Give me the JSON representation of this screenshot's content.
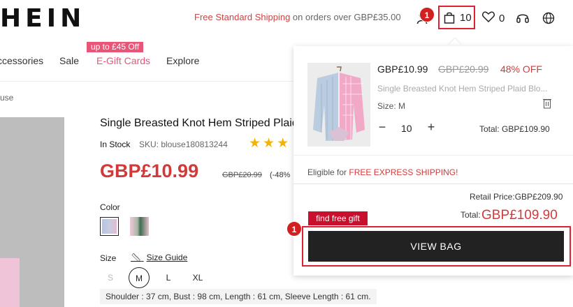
{
  "header": {
    "logo": "HEIN",
    "shipping_highlight": "Free Standard Shipping",
    "shipping_rest": " on orders over GBP£35.00",
    "bag_count": "10",
    "wishlist_count": "0",
    "step_badge": "1"
  },
  "nav": {
    "promo_tag": "up to £45 Off",
    "items": [
      "ccessories",
      "Sale",
      "E-Gift Cards",
      "Explore"
    ]
  },
  "product": {
    "breadcrumb": "use",
    "title": "Single Breasted Knot Hem Striped Plaid",
    "stock": "In Stock",
    "sku": "SKU: blouse180813244",
    "stars": "★★★",
    "price": "GBP£10.99",
    "old_price": "GBP£20.99",
    "discount": "(-48%",
    "color_label": "Color",
    "size_label": "Size",
    "size_guide": "Size Guide",
    "sizes": [
      "S",
      "M",
      "L",
      "XL"
    ],
    "selected_size": "M",
    "measurements": "Shoulder : 37 cm,  Bust : 98 cm,  Length : 61 cm,  Sleeve Length : 61 cm."
  },
  "cart_dropdown": {
    "item": {
      "price": "GBP£10.99",
      "old_price": "GBP£20.99",
      "off": "48% OFF",
      "name": "Single Breasted Knot Hem Striped Plaid Blo...",
      "size": "Size: M",
      "quantity": "10",
      "minus": "−",
      "plus": "+",
      "total": "Total: GBP£109.90"
    },
    "eligible_prefix": "Eligible for ",
    "eligible_highlight": "FREE EXPRESS SHIPPING!",
    "retail_price": "Retail Price:GBP£209.90",
    "total_label": "Total:",
    "total_value": "GBP£109.90",
    "gift_tag": "find free gift",
    "view_bag": "VIEW BAG",
    "step_badge": "1"
  },
  "colors": {
    "brand_red": "#d23a3a",
    "promo_pink": "#e85577",
    "button_dark": "#222222"
  }
}
